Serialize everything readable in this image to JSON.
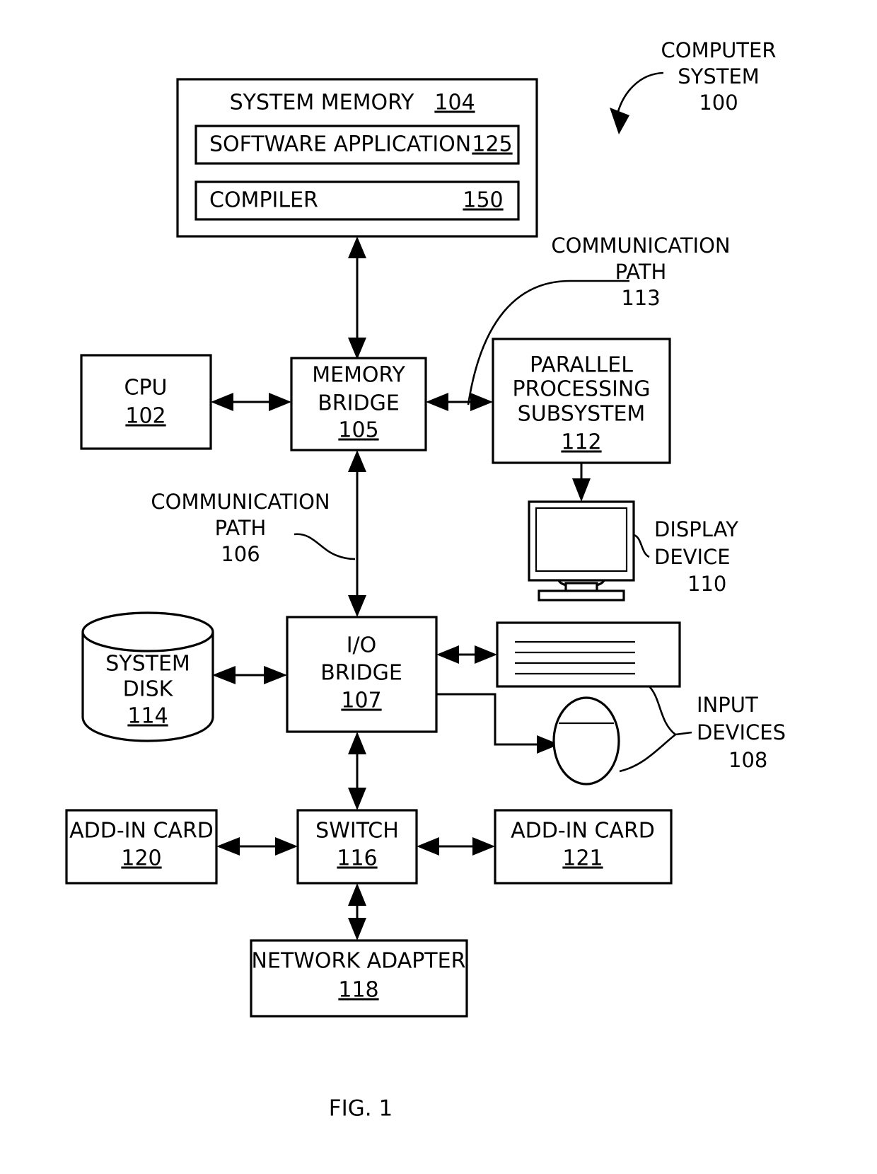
{
  "figure": {
    "caption": "FIG. 1",
    "title_callout": {
      "line1": "COMPUTER",
      "line2": "SYSTEM",
      "number": "100"
    }
  },
  "blocks": {
    "system_memory": {
      "label": "SYSTEM MEMORY",
      "number": "104",
      "children": [
        {
          "label": "SOFTWARE APPLICATION",
          "number": "125"
        },
        {
          "label": "COMPILER",
          "number": "150"
        }
      ]
    },
    "cpu": {
      "label": "CPU",
      "number": "102"
    },
    "memory_bridge": {
      "line1": "MEMORY",
      "line2": "BRIDGE",
      "number": "105"
    },
    "parallel_processing_subsystem": {
      "line1": "PARALLEL",
      "line2": "PROCESSING",
      "line3": "SUBSYSTEM",
      "number": "112"
    },
    "display_device": {
      "line1": "DISPLAY",
      "line2": "DEVICE",
      "number": "110"
    },
    "system_disk": {
      "line1": "SYSTEM",
      "line2": "DISK",
      "number": "114"
    },
    "io_bridge": {
      "line1": "I/O",
      "line2": "BRIDGE",
      "number": "107"
    },
    "input_devices": {
      "line1": "INPUT",
      "line2": "DEVICES",
      "number": "108"
    },
    "add_in_card_left": {
      "label": "ADD-IN CARD",
      "number": "120"
    },
    "switch": {
      "label": "SWITCH",
      "number": "116"
    },
    "add_in_card_right": {
      "label": "ADD-IN CARD",
      "number": "121"
    },
    "network_adapter": {
      "label": "NETWORK ADAPTER",
      "number": "118"
    }
  },
  "callouts": {
    "communication_path_113": {
      "line1": "COMMUNICATION",
      "line2": "PATH",
      "number": "113"
    },
    "communication_path_106": {
      "line1": "COMMUNICATION",
      "line2": "PATH",
      "number": "106"
    }
  },
  "colors": {
    "stroke": "#000000",
    "background": "#ffffff"
  }
}
